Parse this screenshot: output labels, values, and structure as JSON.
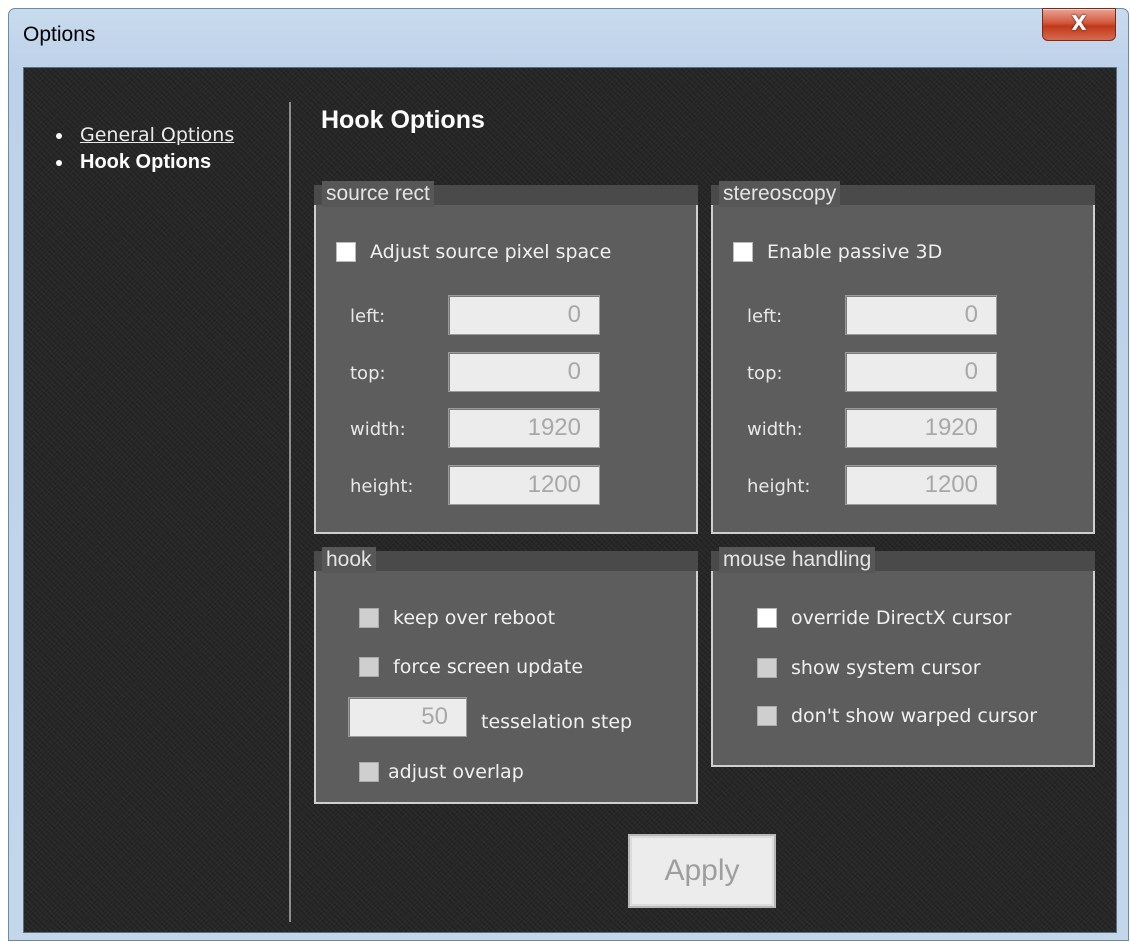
{
  "window": {
    "title": "Options",
    "close_label": "X"
  },
  "nav": {
    "items": [
      {
        "label": "General Options"
      },
      {
        "label": "Hook Options"
      }
    ]
  },
  "page": {
    "title": "Hook Options"
  },
  "source_rect": {
    "legend": "source rect",
    "checkbox_label": "Adjust source pixel space",
    "fields": [
      {
        "label": "left:",
        "value": "0"
      },
      {
        "label": "top:",
        "value": "0"
      },
      {
        "label": "width:",
        "value": "1920"
      },
      {
        "label": "height:",
        "value": "1200"
      }
    ]
  },
  "stereoscopy": {
    "legend": "stereoscopy",
    "checkbox_label": "Enable passive 3D",
    "fields": [
      {
        "label": "left:",
        "value": "0"
      },
      {
        "label": "top:",
        "value": "0"
      },
      {
        "label": "width:",
        "value": "1920"
      },
      {
        "label": "height:",
        "value": "1200"
      }
    ]
  },
  "hook": {
    "legend": "hook",
    "keep_over_reboot": "keep over reboot",
    "force_screen_update": "force screen update",
    "tesselation_value": "50",
    "tesselation_label": "tesselation step",
    "adjust_overlap": "adjust overlap"
  },
  "mouse_handling": {
    "legend": "mouse handling",
    "override_cursor": "override DirectX cursor",
    "show_system_cursor": "show system cursor",
    "dont_show_warped": "don't show warped cursor"
  },
  "apply_label": "Apply"
}
